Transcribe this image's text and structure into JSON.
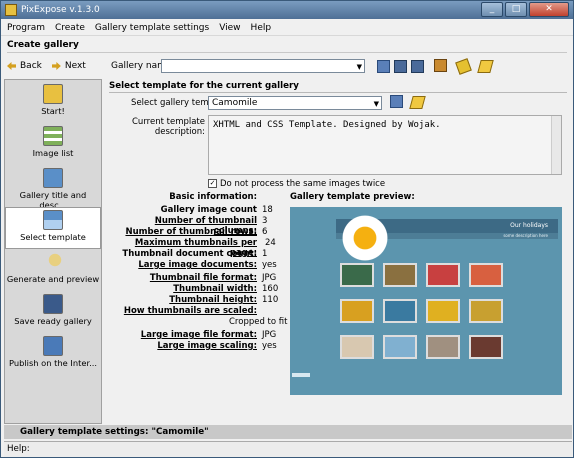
{
  "window": {
    "title": "PixExpose v.1.3.0"
  },
  "menu": [
    "Program",
    "Create",
    "Gallery template settings",
    "View",
    "Help"
  ],
  "page_title": "Create gallery",
  "toolbar": {
    "back": "Back",
    "next": "Next",
    "gallery_name_label": "Gallery name:",
    "gallery_name_value": ""
  },
  "sidebar": {
    "items": [
      {
        "label": "Start!",
        "icon": "start-icon"
      },
      {
        "label": "Image list",
        "icon": "image-list-icon"
      },
      {
        "label": "Gallery title and desc...",
        "icon": "gallery-title-icon"
      },
      {
        "label": "Select template",
        "icon": "select-template-icon",
        "selected": true
      },
      {
        "label": "Generate and preview",
        "icon": "magnifier-icon"
      },
      {
        "label": "Save ready gallery",
        "icon": "floppy-icon"
      },
      {
        "label": "Publish on the Inter...",
        "icon": "publish-icon"
      }
    ]
  },
  "main": {
    "section_title": "Select template for the current gallery",
    "template_label": "Select gallery template:",
    "template_value": "Camomile",
    "desc_label_1": "Current template",
    "desc_label_2": "description:",
    "desc_value": "XHTML and CSS Template. Designed by Wojak.",
    "checkbox_label": "Do not process the same images twice",
    "basic_info_title": "Basic information:",
    "preview_title": "Gallery template preview:",
    "info": [
      {
        "label": "Gallery image count",
        "value": "18"
      },
      {
        "label": "Number of thumbnail columns:",
        "value": "3"
      },
      {
        "label": "Number of thumbnail rows:",
        "value": "6"
      },
      {
        "label": "Maximum thumbnails per page:",
        "value": "24"
      },
      {
        "label": "Thumbnail document count:",
        "value": "1"
      },
      {
        "label": "Large image documents:",
        "value": "yes"
      },
      {
        "label": "Thumbnail file format:",
        "value": "JPG"
      },
      {
        "label": "Thumbnail width:",
        "value": "160"
      },
      {
        "label": "Thumbnail height:",
        "value": "110"
      },
      {
        "label": "How thumbnails are scaled:",
        "value": "Cropped to fit"
      },
      {
        "label": "Large image file format:",
        "value": "JPG"
      },
      {
        "label": "Large image scaling:",
        "value": "yes"
      }
    ],
    "preview": {
      "header": "Our holidays",
      "sub": "some description here"
    }
  },
  "status": "Gallery template settings: \"Camomile\"",
  "help": "Help:"
}
